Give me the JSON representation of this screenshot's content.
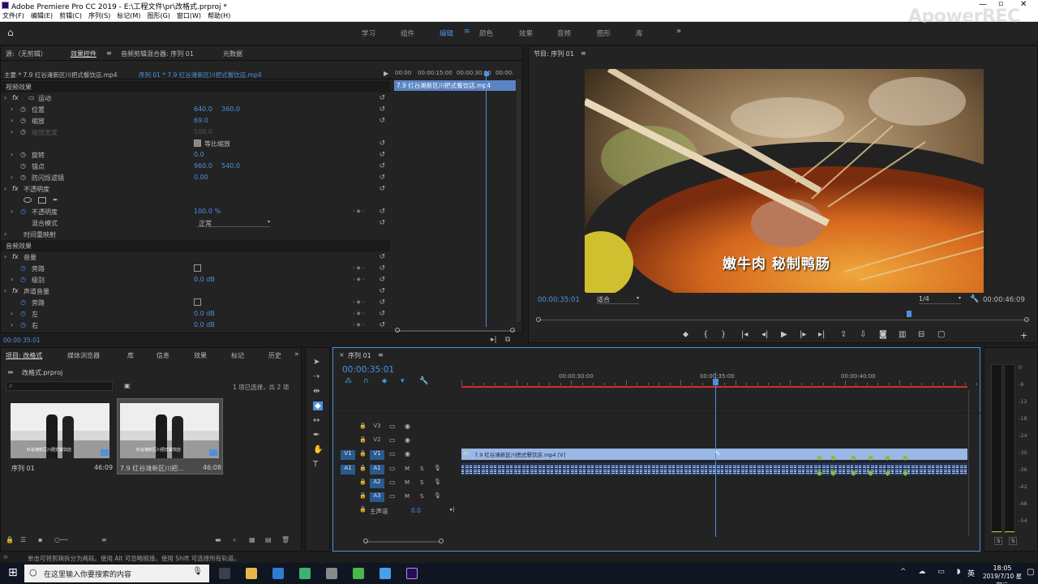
{
  "window": {
    "title": "Adobe Premiere Pro CC 2019 - E:\\工程文件\\pr\\改格式.prproj *",
    "watermark": "ApowerREC"
  },
  "menu": [
    "文件(F)",
    "编辑(E)",
    "剪辑(C)",
    "序列(S)",
    "标记(M)",
    "图形(G)",
    "窗口(W)",
    "帮助(H)"
  ],
  "workspaces": [
    "学习",
    "组件",
    "编辑",
    "颜色",
    "效果",
    "音频",
    "图形",
    "库"
  ],
  "source_panel": {
    "tabs": [
      "源:（无剪辑）",
      "效果控件",
      "音频剪辑混合器: 序列 01",
      "元数据"
    ],
    "master": "主要 * 7.9 红谷滩新区川把式餐饮店.mp4",
    "sequence_clip": "序列 01 * 7.9 红谷滩新区川把式餐饮店.mp4",
    "mini_times": [
      "00:00",
      "00:00:15:00",
      "00:00:30:00",
      "00:00:"
    ],
    "mini_clip": "7.9 红谷滩新区川把式餐饮店.mp4",
    "timecode": "00:00:35:01",
    "video_label": "视频效果",
    "audio_label": "音频效果",
    "motion": "运动",
    "position": {
      "label": "位置",
      "x": "640.0",
      "y": "360.0"
    },
    "scale": {
      "label": "缩放",
      "value": "69.0"
    },
    "scale_width": {
      "label": "缩放宽度",
      "value": "100.0"
    },
    "uniform": "等比缩放",
    "rotation": {
      "label": "旋转",
      "value": "0.0"
    },
    "anchor": {
      "label": "锚点",
      "x": "960.0",
      "y": "540.0"
    },
    "antiflicker": {
      "label": "防闪烁滤镜",
      "value": "0.00"
    },
    "opacity_group": "不透明度",
    "opacity": {
      "label": "不透明度",
      "value": "100.0 %"
    },
    "blend": {
      "label": "混合模式",
      "value": "正常"
    },
    "time_remap": "时间重映射",
    "volume": "音量",
    "bypass": "旁路",
    "level": {
      "label": "级别",
      "value": "0.0 dB"
    },
    "channel_volume": "声道音量",
    "bypass2": "旁路",
    "left": {
      "label": "左",
      "value": "0.0 dB"
    },
    "right": {
      "label": "右",
      "value": "0.0 dB"
    }
  },
  "program": {
    "title": "节目: 序列 01",
    "subtitle": "嫩牛肉 秘制鸭肠",
    "timecode": "00:00:35:01",
    "fit": "适合",
    "quality": "1/4",
    "duration": "00:00:46:09"
  },
  "project": {
    "tabs": [
      "项目: 改格式",
      "媒体浏览器",
      "库",
      "信息",
      "效果",
      "标记",
      "历史"
    ],
    "file": "改格式.prproj",
    "count": "1 项已选择，共 2 项",
    "items": [
      {
        "name": "序列 01",
        "duration": "46:09"
      },
      {
        "name": "7.9 红谷滩新区川把...",
        "duration": "46:08"
      }
    ],
    "thumb_caption": "红谷滩新区川把式餐饮店"
  },
  "timeline": {
    "tab": "序列 01",
    "timecode": "00:00:35:01",
    "ruler": [
      "00:00:30:00",
      "00:00:35:00",
      "00:00:40:00"
    ],
    "video_tracks": [
      "V3",
      "V2",
      "V1"
    ],
    "audio_tracks": [
      "A1",
      "A2",
      "A3"
    ],
    "src_v": "V1",
    "src_a": "A1",
    "master": "主声道",
    "master_val": "0.0",
    "clip_video": "7.9 红谷滩新区川把式餐饮店.mp4 [V]",
    "mute": "M",
    "solo": "S"
  },
  "meter": {
    "labels": [
      "0",
      "-6",
      "-12",
      "-18",
      "-24",
      "-30",
      "-36",
      "-42",
      "-48",
      "-54"
    ],
    "solo": "S"
  },
  "status": "单击可将剪辑拆分为两段。使用 Alt 可忽略链接。使用 Shift 可选择所有轨道。",
  "taskbar": {
    "search": "在这里输入你要搜索的内容",
    "time": "18:05",
    "date": "2019/7/10 星期三",
    "lang": "英"
  },
  "colors": {
    "accent": "#4d90e0",
    "clip": "#9ab8e6",
    "playhead": "#4d90e0",
    "workarea": "#d03030"
  }
}
